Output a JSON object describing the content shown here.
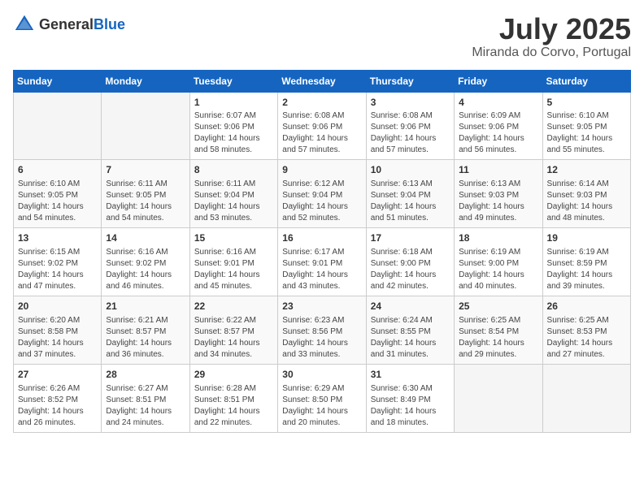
{
  "header": {
    "logo_general": "General",
    "logo_blue": "Blue",
    "month": "July 2025",
    "location": "Miranda do Corvo, Portugal"
  },
  "columns": [
    "Sunday",
    "Monday",
    "Tuesday",
    "Wednesday",
    "Thursday",
    "Friday",
    "Saturday"
  ],
  "weeks": [
    [
      {
        "day": "",
        "info": ""
      },
      {
        "day": "",
        "info": ""
      },
      {
        "day": "1",
        "info": "Sunrise: 6:07 AM\nSunset: 9:06 PM\nDaylight: 14 hours and 58 minutes."
      },
      {
        "day": "2",
        "info": "Sunrise: 6:08 AM\nSunset: 9:06 PM\nDaylight: 14 hours and 57 minutes."
      },
      {
        "day": "3",
        "info": "Sunrise: 6:08 AM\nSunset: 9:06 PM\nDaylight: 14 hours and 57 minutes."
      },
      {
        "day": "4",
        "info": "Sunrise: 6:09 AM\nSunset: 9:06 PM\nDaylight: 14 hours and 56 minutes."
      },
      {
        "day": "5",
        "info": "Sunrise: 6:10 AM\nSunset: 9:05 PM\nDaylight: 14 hours and 55 minutes."
      }
    ],
    [
      {
        "day": "6",
        "info": "Sunrise: 6:10 AM\nSunset: 9:05 PM\nDaylight: 14 hours and 54 minutes."
      },
      {
        "day": "7",
        "info": "Sunrise: 6:11 AM\nSunset: 9:05 PM\nDaylight: 14 hours and 54 minutes."
      },
      {
        "day": "8",
        "info": "Sunrise: 6:11 AM\nSunset: 9:04 PM\nDaylight: 14 hours and 53 minutes."
      },
      {
        "day": "9",
        "info": "Sunrise: 6:12 AM\nSunset: 9:04 PM\nDaylight: 14 hours and 52 minutes."
      },
      {
        "day": "10",
        "info": "Sunrise: 6:13 AM\nSunset: 9:04 PM\nDaylight: 14 hours and 51 minutes."
      },
      {
        "day": "11",
        "info": "Sunrise: 6:13 AM\nSunset: 9:03 PM\nDaylight: 14 hours and 49 minutes."
      },
      {
        "day": "12",
        "info": "Sunrise: 6:14 AM\nSunset: 9:03 PM\nDaylight: 14 hours and 48 minutes."
      }
    ],
    [
      {
        "day": "13",
        "info": "Sunrise: 6:15 AM\nSunset: 9:02 PM\nDaylight: 14 hours and 47 minutes."
      },
      {
        "day": "14",
        "info": "Sunrise: 6:16 AM\nSunset: 9:02 PM\nDaylight: 14 hours and 46 minutes."
      },
      {
        "day": "15",
        "info": "Sunrise: 6:16 AM\nSunset: 9:01 PM\nDaylight: 14 hours and 45 minutes."
      },
      {
        "day": "16",
        "info": "Sunrise: 6:17 AM\nSunset: 9:01 PM\nDaylight: 14 hours and 43 minutes."
      },
      {
        "day": "17",
        "info": "Sunrise: 6:18 AM\nSunset: 9:00 PM\nDaylight: 14 hours and 42 minutes."
      },
      {
        "day": "18",
        "info": "Sunrise: 6:19 AM\nSunset: 9:00 PM\nDaylight: 14 hours and 40 minutes."
      },
      {
        "day": "19",
        "info": "Sunrise: 6:19 AM\nSunset: 8:59 PM\nDaylight: 14 hours and 39 minutes."
      }
    ],
    [
      {
        "day": "20",
        "info": "Sunrise: 6:20 AM\nSunset: 8:58 PM\nDaylight: 14 hours and 37 minutes."
      },
      {
        "day": "21",
        "info": "Sunrise: 6:21 AM\nSunset: 8:57 PM\nDaylight: 14 hours and 36 minutes."
      },
      {
        "day": "22",
        "info": "Sunrise: 6:22 AM\nSunset: 8:57 PM\nDaylight: 14 hours and 34 minutes."
      },
      {
        "day": "23",
        "info": "Sunrise: 6:23 AM\nSunset: 8:56 PM\nDaylight: 14 hours and 33 minutes."
      },
      {
        "day": "24",
        "info": "Sunrise: 6:24 AM\nSunset: 8:55 PM\nDaylight: 14 hours and 31 minutes."
      },
      {
        "day": "25",
        "info": "Sunrise: 6:25 AM\nSunset: 8:54 PM\nDaylight: 14 hours and 29 minutes."
      },
      {
        "day": "26",
        "info": "Sunrise: 6:25 AM\nSunset: 8:53 PM\nDaylight: 14 hours and 27 minutes."
      }
    ],
    [
      {
        "day": "27",
        "info": "Sunrise: 6:26 AM\nSunset: 8:52 PM\nDaylight: 14 hours and 26 minutes."
      },
      {
        "day": "28",
        "info": "Sunrise: 6:27 AM\nSunset: 8:51 PM\nDaylight: 14 hours and 24 minutes."
      },
      {
        "day": "29",
        "info": "Sunrise: 6:28 AM\nSunset: 8:51 PM\nDaylight: 14 hours and 22 minutes."
      },
      {
        "day": "30",
        "info": "Sunrise: 6:29 AM\nSunset: 8:50 PM\nDaylight: 14 hours and 20 minutes."
      },
      {
        "day": "31",
        "info": "Sunrise: 6:30 AM\nSunset: 8:49 PM\nDaylight: 14 hours and 18 minutes."
      },
      {
        "day": "",
        "info": ""
      },
      {
        "day": "",
        "info": ""
      }
    ]
  ]
}
